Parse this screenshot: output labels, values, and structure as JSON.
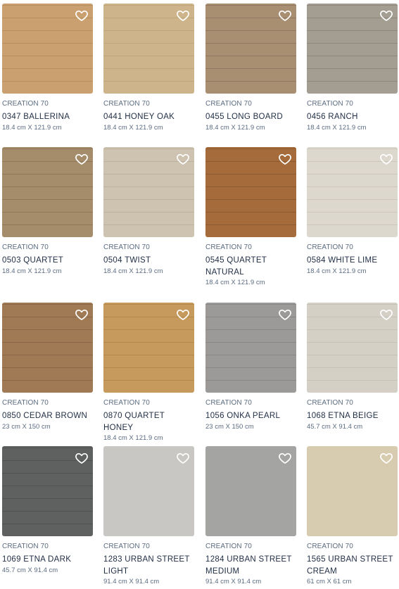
{
  "products": [
    {
      "collection": "CREATION 70",
      "name": "0347 BALLERINA",
      "size": "18.4 cm X 121.9 cm",
      "color": "#caa070",
      "plank_color": "#b88e5f"
    },
    {
      "collection": "CREATION 70",
      "name": "0441 HONEY OAK",
      "size": "18.4 cm X 121.9 cm",
      "color": "#cdb48a",
      "plank_color": "#bfa679"
    },
    {
      "collection": "CREATION 70",
      "name": "0455 LONG BOARD",
      "size": "18.4 cm X 121.9 cm",
      "color": "#a98f72",
      "plank_color": "#8f7760"
    },
    {
      "collection": "CREATION 70",
      "name": "0456 RANCH",
      "size": "18.4 cm X 121.9 cm",
      "color": "#a39d92",
      "plank_color": "#8e877c"
    },
    {
      "collection": "CREATION 70",
      "name": "0503 QUARTET",
      "size": "18.4 cm X 121.9 cm",
      "color": "#a58d6c",
      "plank_color": "#8e7758"
    },
    {
      "collection": "CREATION 70",
      "name": "0504 TWIST",
      "size": "18.4 cm X 121.9 cm",
      "color": "#cdc3b0",
      "plank_color": "#bcb29e"
    },
    {
      "collection": "CREATION 70",
      "name": "0545 QUARTET NATURAL",
      "size": "18.4 cm X 121.9 cm",
      "color": "#a56b3a",
      "plank_color": "#8d5a2f"
    },
    {
      "collection": "CREATION 70",
      "name": "0584 WHITE LIME",
      "size": "18.4 cm X 121.9 cm",
      "color": "#ddd8cd",
      "plank_color": "#cdc7bb"
    },
    {
      "collection": "CREATION 70",
      "name": "0850 CEDAR BROWN",
      "size": "23 cm X 150 cm",
      "color": "#a07a55",
      "plank_color": "#8a6646"
    },
    {
      "collection": "CREATION 70",
      "name": "0870 QUARTET HONEY",
      "size": "18.4 cm X 121.9 cm",
      "color": "#c69a5c",
      "plank_color": "#b3884d"
    },
    {
      "collection": "CREATION 70",
      "name": "1056 ONKA PEARL",
      "size": "23 cm X 150 cm",
      "color": "#9b9a98",
      "plank_color": "#888785"
    },
    {
      "collection": "CREATION 70",
      "name": "1068 ETNA BEIGE",
      "size": "45.7 cm X 91.4 cm",
      "color": "#d4d0c5",
      "plank_color": "#c6c1b5"
    },
    {
      "collection": "CREATION 70",
      "name": "1069 ETNA DARK",
      "size": "45.7 cm X 91.4 cm",
      "color": "#5e615f",
      "plank_color": "#4f5250"
    },
    {
      "collection": "CREATION 70",
      "name": "1283 URBAN STREET LIGHT",
      "size": "91.4 cm X 91.4 cm",
      "color": "#c9c7c3",
      "plank_color": "#c9c7c3"
    },
    {
      "collection": "CREATION 70",
      "name": "1284 URBAN STREET MEDIUM",
      "size": "91.4 cm X 91.4 cm",
      "color": "#a4a4a3",
      "plank_color": "#a4a4a3"
    },
    {
      "collection": "CREATION 70",
      "name": "1565 URBAN STREET CREAM",
      "size": "61 cm X 61 cm",
      "color": "#d8ccb0",
      "plank_color": "#d8ccb0"
    }
  ]
}
